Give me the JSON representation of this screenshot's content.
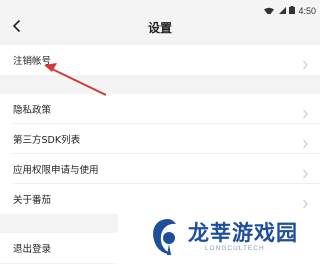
{
  "status_bar": {
    "time": "4:50"
  },
  "nav": {
    "title": "设置"
  },
  "groups": [
    {
      "items": [
        {
          "label": "注销帐号"
        }
      ]
    },
    {
      "items": [
        {
          "label": "隐私政策"
        },
        {
          "label": "第三方SDK列表"
        },
        {
          "label": "应用权限申请与使用"
        },
        {
          "label": "关于番茄"
        }
      ]
    },
    {
      "items": [
        {
          "label": "退出登录"
        }
      ]
    }
  ],
  "watermark": {
    "title": "龙莘游戏园",
    "subtitle": "LONGCULTECH"
  },
  "colors": {
    "annotation_arrow": "#d23a3a",
    "watermark": "#1e4f9c"
  }
}
